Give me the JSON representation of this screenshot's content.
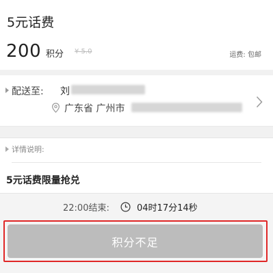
{
  "product": {
    "title": "5元话费",
    "points": "200",
    "points_unit": "积分",
    "original_price": "¥ 5.0",
    "shipping": "运费: 包邮"
  },
  "address": {
    "label": "配送至:",
    "recipient_name": "刘",
    "location": "广东省 广州市"
  },
  "details": {
    "label": "详情说明:",
    "promo_text": "5元话费限量抢兑"
  },
  "timer": {
    "end_label": "22:00结束:",
    "countdown": "04时17分14秒"
  },
  "action": {
    "button_label": "积分不足",
    "outline_color": "#e02626",
    "button_color": "#bcbcbc"
  },
  "icons": [
    "triangle-right-icon",
    "location-pin-icon",
    "chevron-right-icon",
    "clock-icon"
  ]
}
